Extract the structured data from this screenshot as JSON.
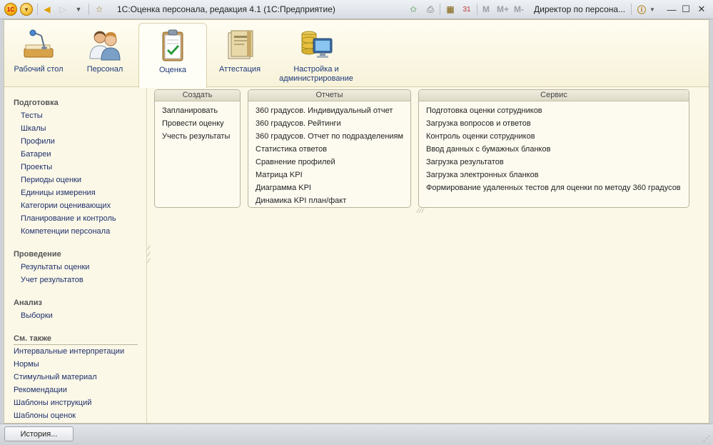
{
  "window": {
    "title": "1С:Оценка персонала, редакция 4.1  (1С:Предприятие)",
    "user": "Директор по персона...",
    "memory_buttons": [
      "M",
      "M+",
      "M-"
    ]
  },
  "sections": [
    {
      "label": "Рабочий стол",
      "icon": "desk-lamp-icon"
    },
    {
      "label": "Персонал",
      "icon": "people-icon"
    },
    {
      "label": "Оценка",
      "icon": "clipboard-check-icon",
      "active": true
    },
    {
      "label": "Аттестация",
      "icon": "folder-docs-icon"
    },
    {
      "label": "Настройка и администрирование",
      "icon": "database-monitor-icon"
    }
  ],
  "sidebar": {
    "groups": [
      {
        "title": "Подготовка",
        "items": [
          "Тесты",
          "Шкалы",
          "Профили",
          "Батареи",
          "Проекты",
          "Периоды оценки",
          "Единицы измерения",
          "Категории оценивающих",
          "Планирование и контроль",
          "Компетенции персонала"
        ]
      },
      {
        "title": "Проведение",
        "items": [
          "Результаты оценки",
          "Учет результатов"
        ]
      },
      {
        "title": "Анализ",
        "items": [
          "Выборки"
        ]
      }
    ],
    "see_also": {
      "title": "См. также",
      "items": [
        "Интервальные интерпретации",
        "Нормы",
        "Стимульный материал",
        "Рекомендации",
        "Шаблоны инструкций",
        "Шаблоны оценок"
      ]
    }
  },
  "panels": {
    "create": {
      "title": "Создать",
      "items": [
        "Запланировать",
        "Провести оценку",
        "Учесть результаты"
      ]
    },
    "reports": {
      "title": "Отчеты",
      "items": [
        "360 градусов. Индивидуальный отчет",
        "360 градусов. Рейтинги",
        "360 градусов. Отчет по подразделениям",
        "Статистика ответов",
        "Сравнение профилей",
        "Матрица KPI",
        "Диаграмма KPI",
        "Динамика KPI план/факт"
      ]
    },
    "service": {
      "title": "Сервис",
      "items": [
        "Подготовка оценки сотрудников",
        "Загрузка вопросов и ответов",
        "Контроль оценки сотрудников",
        "Ввод данных с бумажных бланков",
        "Загрузка результатов",
        "Загрузка электронных бланков",
        "Формирование удаленных тестов для оценки по методу 360 градусов"
      ]
    }
  },
  "statusbar": {
    "history_label": "История..."
  }
}
